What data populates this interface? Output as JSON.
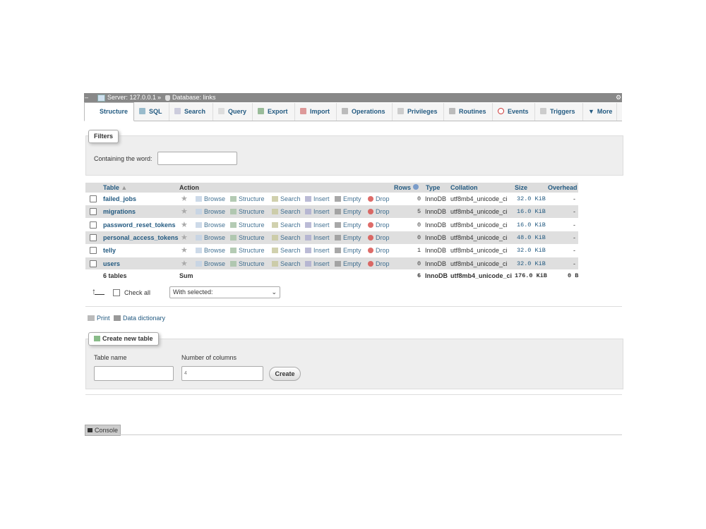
{
  "breadcrumb": {
    "server": "Server: 127.0.0.1",
    "separator": "»",
    "database": "Database: links"
  },
  "tabs": [
    {
      "label": "Structure",
      "icon": "structure-icon"
    },
    {
      "label": "SQL",
      "icon": "sql-icon"
    },
    {
      "label": "Search",
      "icon": "search-icon"
    },
    {
      "label": "Query",
      "icon": "query-icon"
    },
    {
      "label": "Export",
      "icon": "export-icon"
    },
    {
      "label": "Import",
      "icon": "import-icon"
    },
    {
      "label": "Operations",
      "icon": "wrench-icon"
    },
    {
      "label": "Privileges",
      "icon": "privileges-icon"
    },
    {
      "label": "Routines",
      "icon": "routines-icon"
    },
    {
      "label": "Events",
      "icon": "clock-icon"
    },
    {
      "label": "Triggers",
      "icon": "triggers-icon"
    },
    {
      "label": "More",
      "icon": "caret-down-icon"
    }
  ],
  "filters": {
    "legend": "Filters",
    "label": "Containing the word:",
    "value": ""
  },
  "table": {
    "headers": {
      "table": "Table",
      "action": "Action",
      "rows": "Rows",
      "type": "Type",
      "collation": "Collation",
      "size": "Size",
      "overhead": "Overhead"
    },
    "actions": [
      "Browse",
      "Structure",
      "Search",
      "Insert",
      "Empty",
      "Drop"
    ],
    "rows": [
      {
        "name": "failed_jobs",
        "rows": "0",
        "type": "InnoDB",
        "collation": "utf8mb4_unicode_ci",
        "size": "32.0 KiB",
        "overhead": "-"
      },
      {
        "name": "migrations",
        "rows": "5",
        "type": "InnoDB",
        "collation": "utf8mb4_unicode_ci",
        "size": "16.0 KiB",
        "overhead": "-"
      },
      {
        "name": "password_reset_tokens",
        "rows": "0",
        "type": "InnoDB",
        "collation": "utf8mb4_unicode_ci",
        "size": "16.0 KiB",
        "overhead": "-"
      },
      {
        "name": "personal_access_tokens",
        "rows": "0",
        "type": "InnoDB",
        "collation": "utf8mb4_unicode_ci",
        "size": "48.0 KiB",
        "overhead": "-"
      },
      {
        "name": "telly",
        "rows": "1",
        "type": "InnoDB",
        "collation": "utf8mb4_unicode_ci",
        "size": "32.0 KiB",
        "overhead": "-"
      },
      {
        "name": "users",
        "rows": "0",
        "type": "InnoDB",
        "collation": "utf8mb4_unicode_ci",
        "size": "32.0 KiB",
        "overhead": "-"
      }
    ],
    "footer": {
      "count": "6 tables",
      "sum": "Sum",
      "rows": "6",
      "type": "InnoDB",
      "collation": "utf8mb4_unicode_ci",
      "size": "176.0 KiB",
      "overhead": "0 B"
    }
  },
  "bulk": {
    "check_all": "Check all",
    "with_selected": "With selected:"
  },
  "links": {
    "print": "Print",
    "data_dictionary": "Data dictionary"
  },
  "create_table": {
    "legend": "Create new table",
    "name_label": "Table name",
    "columns_label": "Number of columns",
    "name_value": "",
    "columns_value": "4",
    "button": "Create"
  },
  "console": {
    "label": "Console"
  }
}
